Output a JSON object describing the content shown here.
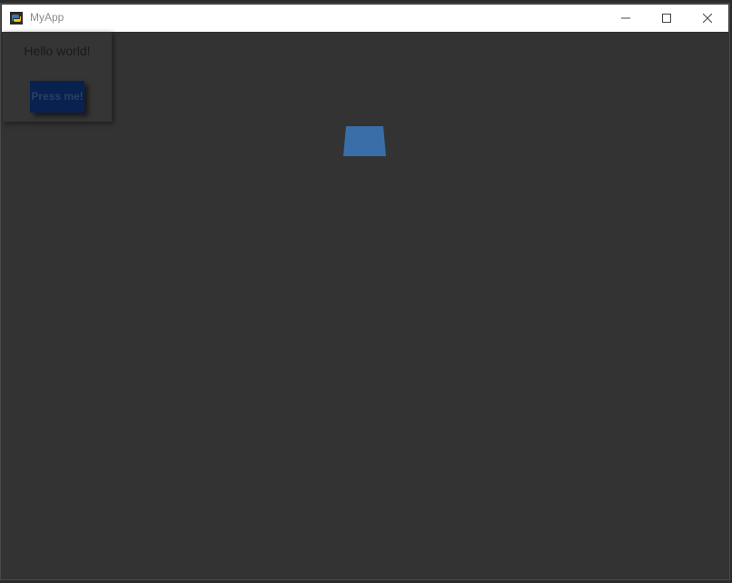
{
  "window": {
    "title": "MyApp",
    "icons": {
      "app": "python-app-icon",
      "minimize": "minimize-icon",
      "maximize": "maximize-icon",
      "close": "close-icon"
    }
  },
  "panel": {
    "label": "Hello world!",
    "button_label": "Press me!"
  },
  "colors": {
    "background": "#333333",
    "titlebar": "#ffffff",
    "button": "#08214f",
    "shape": "#3a6ea8"
  }
}
